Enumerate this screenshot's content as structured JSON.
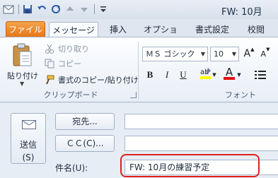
{
  "window": {
    "title": "FW: 10月"
  },
  "quick_access": {
    "icons": [
      "outlook-app-icon",
      "save-icon",
      "undo-icon",
      "redo-icon",
      "up-arrow-icon",
      "down-arrow-icon",
      "customize-toolbar-icon"
    ]
  },
  "tabs": [
    {
      "label": "ファイル"
    },
    {
      "label": "メッセージ"
    },
    {
      "label": "挿入"
    },
    {
      "label": "オプション"
    },
    {
      "label": "書式設定"
    },
    {
      "label": "校閲"
    }
  ],
  "clipboard": {
    "paste_label": "貼り付け",
    "cut_label": "切り取り",
    "copy_label": "コピー",
    "format_painter_label": "書式のコピー/貼り付け",
    "group_label": "クリップボード"
  },
  "font": {
    "name": "ＭＳ ゴシック",
    "size": "10",
    "group_label": "フォント",
    "bold": "B",
    "italic": "I",
    "underline": "U",
    "grow": "A",
    "shrink": "A",
    "color_letter": "A",
    "highlight_color": "#ffff00",
    "font_color": "#e01010"
  },
  "compose": {
    "send_label": "送信",
    "send_key": "(S)",
    "to_button": "宛先...",
    "cc_button": "ＣＣ(C)...",
    "subject_label": "件名(U):",
    "subject_value": "FW: 10月の練習予定"
  },
  "colors": {
    "accent": "#e67519",
    "highlight_box": "#e02020"
  }
}
